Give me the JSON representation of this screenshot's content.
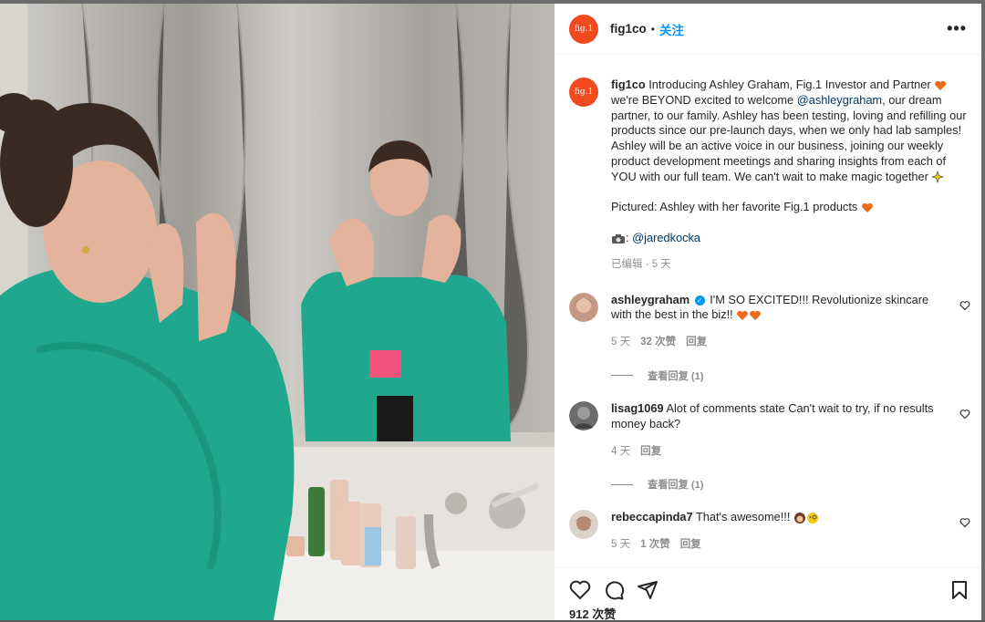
{
  "post": {
    "username": "fig1co",
    "follow_label": "关注",
    "more_label": "•••",
    "logo_text": "fig.1",
    "caption": {
      "username": "fig1co",
      "line1": " Introducing Ashley Graham, Fig.1 Investor and Partner ",
      "line2a": "we're BEYOND excited to welcome ",
      "mention": "@ashleygraham",
      "line2b": ", our dream partner, to our family. Ashley has been testing, loving and refilling our products since our pre-launch days, when we only had lab samples! Ashley will be an active voice in our business, joining our weekly product development meetings and sharing insights from each of YOU with our full team. We can't wait to make magic together ",
      "pictured": "Pictured: Ashley with her favorite Fig.1 products ",
      "photo_credit_sep": ": ",
      "photo_credit": "@jaredkocka",
      "meta": "已编辑 · 5 天"
    },
    "comments": [
      {
        "username": "ashleygraham",
        "verified": true,
        "text": " I'M SO EXCITED!!! Revolutionize skincare with the best in the biz!! ",
        "age": "5 天",
        "likes": "32 次赞",
        "reply": "回复",
        "view_replies": "查看回复 (1)"
      },
      {
        "username": "lisag1069",
        "text": " Alot of comments state Can't wait to try, if no results money back?",
        "age": "4 天",
        "reply": "回复",
        "view_replies": "查看回复 (1)"
      },
      {
        "username": "rebeccapinda7",
        "text": " That's awesome!!! ",
        "age": "5 天",
        "likes": "1 次赞",
        "reply": "回复"
      }
    ],
    "likes_label": "912 次赞"
  },
  "icons": [
    "heart-icon",
    "comment-icon",
    "share-icon",
    "save-icon",
    "more-icon",
    "verified-badge-icon"
  ],
  "colors": {
    "follow": "#0095f6",
    "brand": "#f04a1e",
    "mention": "#00376b",
    "jacket": "#1fa88e"
  }
}
